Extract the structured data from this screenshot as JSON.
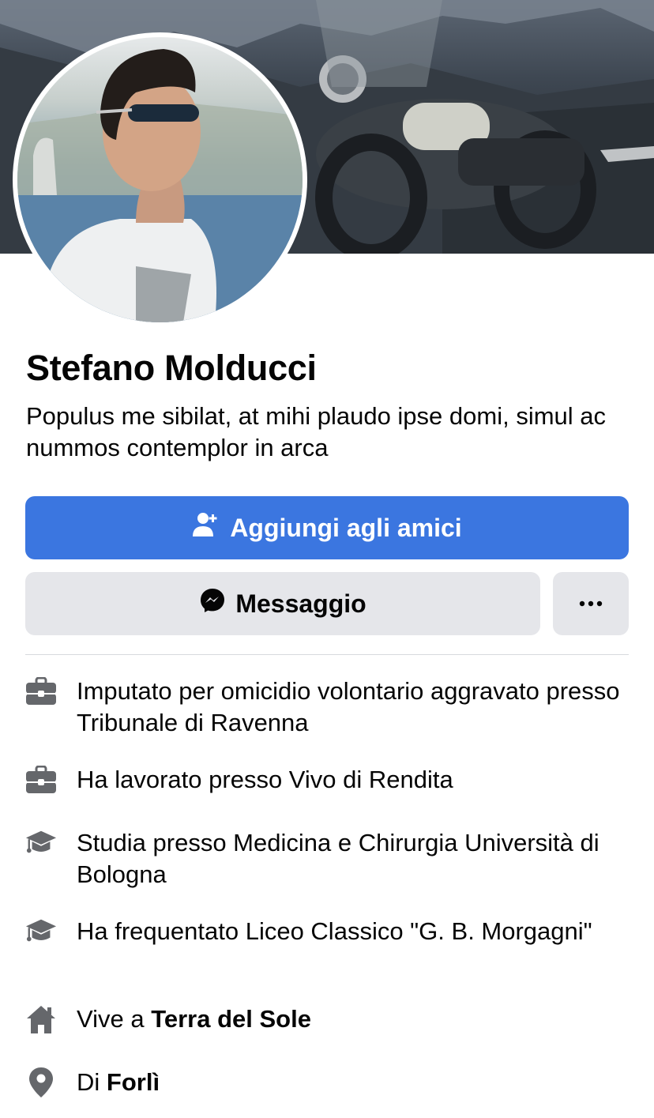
{
  "profile": {
    "name": "Stefano Molducci",
    "bio": "Populus me sibilat, at mihi plaudo ipse domi, simul ac nummos contemplor in arca"
  },
  "actions": {
    "add_friend_label": "Aggiungi agli amici",
    "message_label": "Messaggio",
    "more_label": "•••"
  },
  "info": [
    {
      "icon": "briefcase-icon",
      "text": "Imputato per omicidio volontario aggravato presso Tribunale di Ravenna"
    },
    {
      "icon": "briefcase-icon",
      "text": "Ha lavorato presso Vivo di Rendita"
    },
    {
      "icon": "graduation-cap-icon",
      "text": "Studia presso Medicina e Chirurgia Università di Bologna"
    },
    {
      "icon": "graduation-cap-icon",
      "text": "Ha frequentato Liceo Classico \"G. B. Morgagni\""
    },
    {
      "icon": "home-icon",
      "prefix": "Vive a ",
      "strong": "Terra del Sole"
    },
    {
      "icon": "location-pin-icon",
      "prefix": "Di ",
      "strong": "Forlì"
    }
  ],
  "colors": {
    "primary_button": "#3b76e0",
    "secondary_button": "#e5e6ea",
    "icon_gray": "#65676b"
  }
}
